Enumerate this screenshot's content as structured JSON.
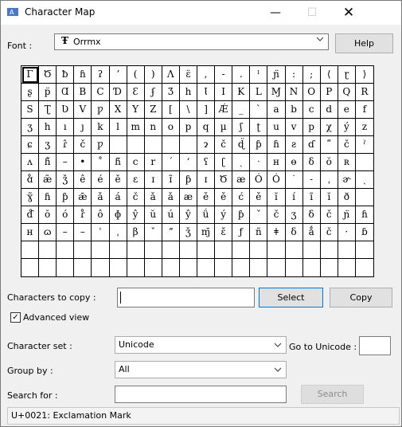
{
  "window": {
    "title": "Character Map",
    "minimize_glyph": "—",
    "maximize_glyph": "☐",
    "close_glyph": "✕"
  },
  "font": {
    "label": "Font :",
    "tt_glyph": "Ŧ",
    "value": "Orrmx",
    "help_label": "Help"
  },
  "grid": {
    "rows": [
      [
        "Γ",
        "Ծ",
        "ƀ",
        "ɦ",
        "ʔ",
        "ʼ",
        "(",
        ")",
        "Ʌ",
        "ɛ̈",
        ",",
        "-",
        ".",
        "ˡ",
        "ɲ̈",
        ":",
        ";",
        "⟨",
        "ɽ",
        "⟩"
      ],
      [
        "ʂ",
        "p̈",
        "Ɑ",
        "B",
        "C",
        "Ɗ",
        "Ɛ",
        "ʄ",
        "Ʒ",
        "h",
        "Ɩ",
        "I",
        "K",
        "L",
        "Ɱ",
        "N",
        "O",
        "P",
        "Q",
        "R"
      ],
      [
        "S",
        "Ʈ",
        "Ʋ",
        "V",
        "ƿ",
        "X",
        "Y",
        "Z",
        "[",
        "\\",
        "]",
        "Ǽ",
        "_",
        "ˋ",
        "a",
        "b",
        "c",
        "d",
        "e",
        "f"
      ],
      [
        "ʒ",
        "h",
        "ı",
        "ȷ",
        "k",
        "l",
        "m",
        "n",
        "o",
        "p",
        "q",
        "µ",
        "ʃ",
        "ʈ",
        "u",
        "v",
        "p",
        "χ",
        "ý",
        "z"
      ],
      [
        "ɕ",
        "ʒ",
        "ɾ̂",
        "č",
        "ƿ",
        " ",
        " ",
        " ",
        " ",
        " ",
        "ɂ",
        "č",
        "ɖ̈",
        "ƥ",
        "ɦ",
        "ƨ",
        "ɗ",
        "ʺ",
        "č",
        "ˀ"
      ],
      [
        "ʌ",
        "ɦ̃",
        "–",
        "•",
        "˚",
        "ɦ̄",
        "c",
        "r",
        "ˊ",
        "ʻ",
        "ʕ",
        "ʗ",
        "ˏ",
        "ˑ",
        "ʜ",
        "ɵ",
        "δ",
        "ŏ",
        "ʀ",
        " "
      ],
      [
        "ɑ̊",
        "æ̃",
        "ǯ",
        "ê",
        "é",
        "ě",
        "ɛ",
        "ɪ",
        "ɪ̃",
        "ƥ",
        "ɪ",
        "Ծ",
        "æ",
        "Ó",
        "Ó",
        "˙",
        "˗",
        "ˌ",
        "ɚ",
        "ˏ"
      ],
      [
        "ɣ̃",
        "ɦ",
        "ƥ",
        "ǣ",
        "ǎ",
        "á",
        "č",
        "ǎ",
        "ǎ",
        "æ",
        "ě",
        "ě",
        "ć",
        "ě",
        "ĭ",
        "í",
        "ĩ",
        "ĭ",
        "ð",
        " "
      ],
      [
        "ɗ̊",
        "ŏ",
        "ó",
        "ɾ̊",
        "ô",
        "ɸ",
        "ŷ",
        "ŭ",
        "ú",
        "ŷ",
        "ǘ",
        "ý",
        "ƥ",
        "ˇ",
        "č",
        "ʒ",
        "δ",
        "č",
        "ɲ̈",
        "ɦ"
      ],
      [
        "ʜ",
        "ɷ",
        "–",
        "–",
        "ˈ",
        "ˌ",
        "β",
        "ˇ",
        "ˮ",
        "ǯ",
        "ɱ̄",
        "ɛ̆",
        "ƒ",
        "ñ",
        "ǂ",
        "δ",
        "ǻ",
        "č",
        "·",
        "ɓ"
      ],
      [
        "",
        "",
        "",
        "",
        "",
        "",
        "",
        "",
        "",
        "",
        "",
        "",
        "",
        "",
        "",
        "",
        "",
        "",
        "",
        ""
      ],
      [
        "",
        "",
        "",
        "",
        "",
        "",
        "",
        "",
        "",
        "",
        "",
        "",
        "",
        "",
        "",
        "",
        "",
        "",
        "",
        ""
      ]
    ]
  },
  "copy": {
    "label": "Characters to copy :",
    "value": "",
    "select_label": "Select",
    "copy_label": "Copy"
  },
  "advanced": {
    "label": "Advanced view",
    "checked": "✓"
  },
  "charset": {
    "label": "Character set :",
    "value": "Unicode",
    "goto_label": "Go to Unicode :",
    "goto_value": ""
  },
  "groupby": {
    "label": "Group by :",
    "value": "All"
  },
  "search": {
    "label": "Search for :",
    "value": "",
    "button_label": "Search"
  },
  "status": {
    "text": "U+0021: Exclamation Mark"
  }
}
